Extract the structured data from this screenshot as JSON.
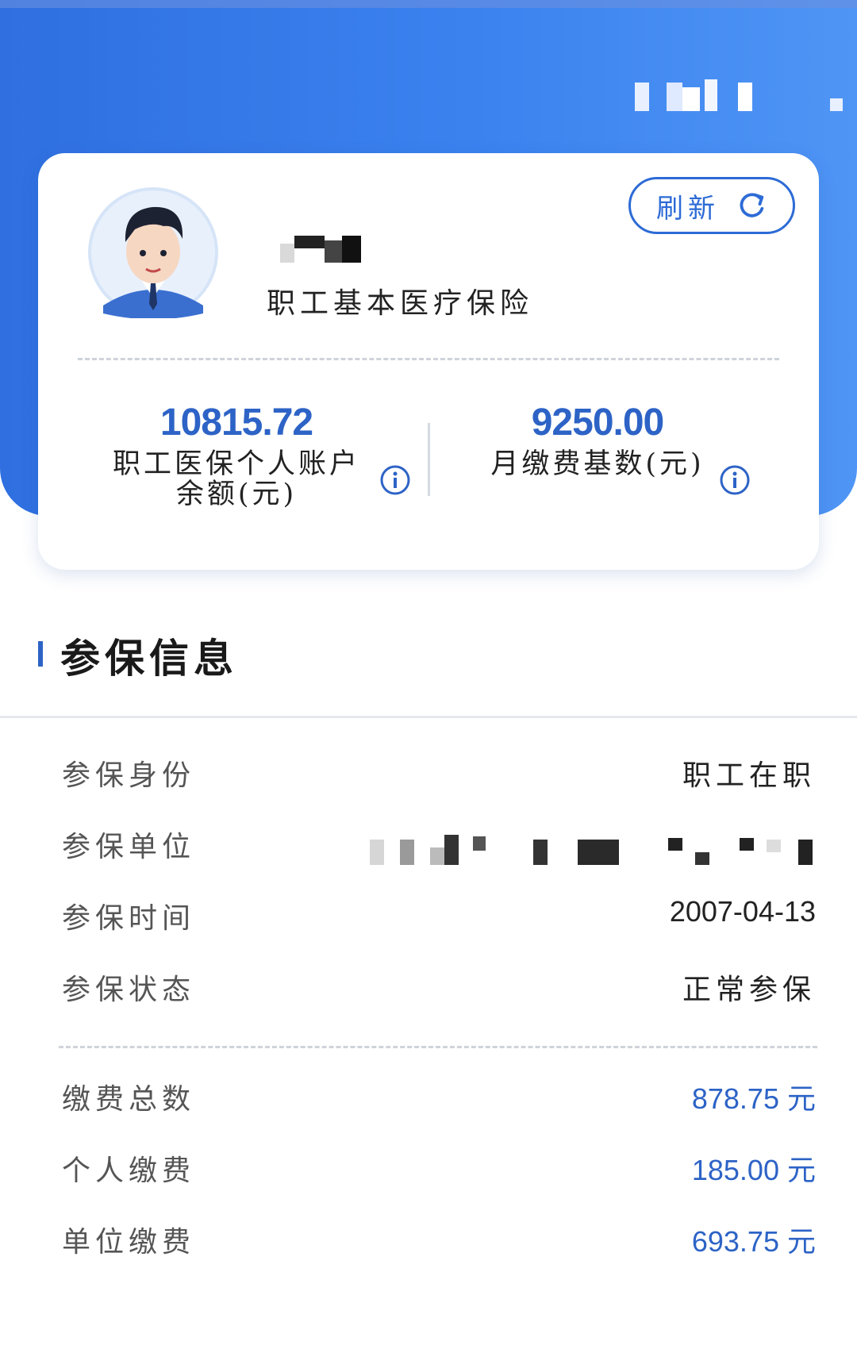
{
  "header": {
    "title_masked": true
  },
  "card": {
    "insurance_type": "职工基本医疗保险",
    "refresh_label": "刷新",
    "stats": [
      {
        "value": "10815.72",
        "label": "职工医保个人账户余额(元)"
      },
      {
        "value": "9250.00",
        "label": "月缴费基数(元)"
      }
    ]
  },
  "section": {
    "title": "参保信息"
  },
  "info": {
    "identity_label": "参保身份",
    "identity_value": "职工在职",
    "unit_label": "参保单位",
    "time_label": "参保时间",
    "time_value": "2007-04-13",
    "status_label": "参保状态",
    "status_value": "正常参保"
  },
  "payment": {
    "total_label": "缴费总数",
    "total_value": "878.75",
    "personal_label": "个人缴费",
    "personal_value": "185.00",
    "employer_label": "单位缴费",
    "employer_value": "693.75",
    "unit": "元"
  },
  "colors": {
    "accent": "#2d63c6",
    "header_bg": "#3b82ef"
  }
}
